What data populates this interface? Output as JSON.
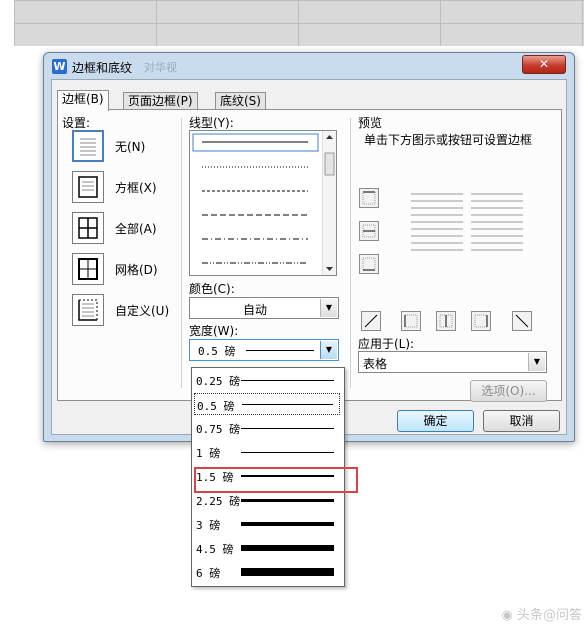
{
  "dialog": {
    "title": "边框和底纹",
    "ghost_title": "对华视"
  },
  "tabs": [
    {
      "label": "边框(B)"
    },
    {
      "label": "页面边框(P)"
    },
    {
      "label": "底纹(S)"
    }
  ],
  "setting": {
    "group_label": "设置:",
    "items": [
      {
        "label": "无(N)"
      },
      {
        "label": "方框(X)"
      },
      {
        "label": "全部(A)"
      },
      {
        "label": "网格(D)"
      },
      {
        "label": "自定义(U)"
      }
    ]
  },
  "line_style": {
    "label": "线型(Y):",
    "styles": [
      "solid",
      "dotted",
      "dashed",
      "long-dash",
      "dash-dot",
      "dash-dot-dot"
    ]
  },
  "color": {
    "label": "颜色(C):",
    "value": "自动"
  },
  "width": {
    "label": "宽度(W):",
    "value": "0.5 磅"
  },
  "preview": {
    "label": "预览",
    "hint": "单击下方图示或按钮可设置边框"
  },
  "apply_to": {
    "label": "应用于(L):",
    "value": "表格"
  },
  "buttons": {
    "options": "选项(O)...",
    "ok": "确定",
    "cancel": "取消"
  },
  "width_options": [
    {
      "label": "0.25 磅",
      "weight": 0.25,
      "selected": false
    },
    {
      "label": "0.5 磅",
      "weight": 0.5,
      "selected": true
    },
    {
      "label": "0.75 磅",
      "weight": 0.75,
      "selected": false
    },
    {
      "label": "1 磅",
      "weight": 1,
      "selected": false
    },
    {
      "label": "1.5 磅",
      "weight": 1.5,
      "selected": false
    },
    {
      "label": "2.25 磅",
      "weight": 2.25,
      "selected": false
    },
    {
      "label": "3 磅",
      "weight": 3,
      "selected": false
    },
    {
      "label": "4.5 磅",
      "weight": 4.5,
      "selected": false
    },
    {
      "label": "6 磅",
      "weight": 6,
      "selected": false
    }
  ],
  "watermark": "头条@问答",
  "colors": {
    "highlight": "#d64545",
    "accent": "#4a90d9"
  }
}
